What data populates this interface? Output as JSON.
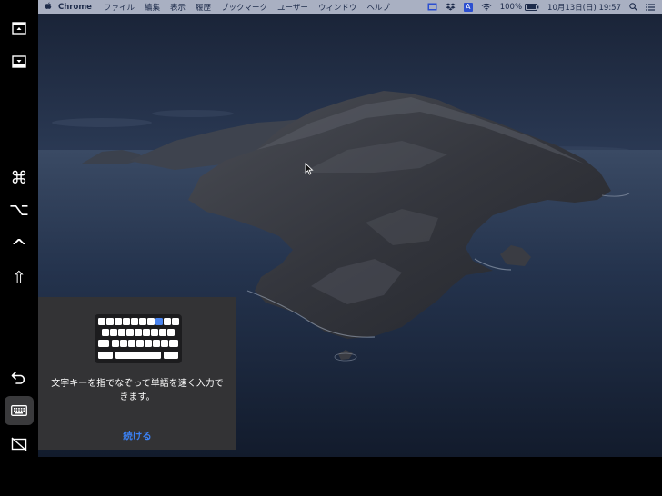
{
  "menubar": {
    "app_name": "Chrome",
    "items": [
      "ファイル",
      "編集",
      "表示",
      "履歴",
      "ブックマーク",
      "ユーザー",
      "ウィンドウ",
      "ヘルプ"
    ],
    "battery": "100%",
    "datetime": "10月13日(日)  19:57",
    "input_mode": "A"
  },
  "sidebar": {
    "buttons": [
      {
        "name": "show-menubar-icon"
      },
      {
        "name": "show-dock-icon"
      },
      {
        "name": "command-key",
        "glyph": "⌘"
      },
      {
        "name": "option-key",
        "glyph": "⌥"
      },
      {
        "name": "control-key",
        "glyph": "^"
      },
      {
        "name": "shift-key",
        "glyph": "⇧"
      },
      {
        "name": "undo-icon"
      },
      {
        "name": "keyboard-icon"
      },
      {
        "name": "disconnect-icon"
      }
    ]
  },
  "popup": {
    "message": "文字キーを指でなぞって単語を速く入力できます。",
    "continue_label": "続ける"
  },
  "colors": {
    "menubar_bg": "#a9b0c2",
    "popup_bg": "#333335",
    "accent": "#3b82f6"
  }
}
